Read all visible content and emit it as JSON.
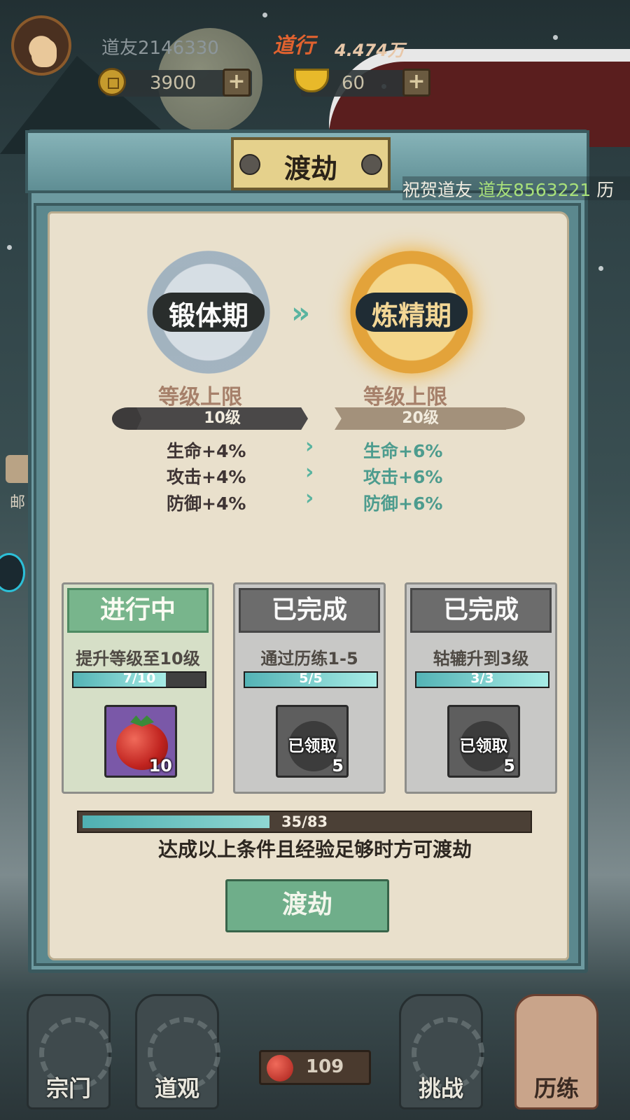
{
  "hud": {
    "username": "道友2146330",
    "daoxing_label": "道行",
    "daoxing_value": "4.474万",
    "coins": "3900",
    "ingots": "60",
    "plus": "+"
  },
  "side": {
    "mail_label": "邮"
  },
  "modal": {
    "title": "渡劫",
    "ticker_prefix": "祝贺道友 ",
    "ticker_name": "道友8563221",
    "ticker_suffix": " 历"
  },
  "realms": {
    "current": {
      "name": "锻体期",
      "cap_title": "等级上限",
      "cap_value": "10级",
      "stats": [
        "生命+4%",
        "攻击+4%",
        "防御+4%"
      ]
    },
    "next": {
      "name": "炼精期",
      "cap_title": "等级上限",
      "cap_value": "20级",
      "stats": [
        "生命+6%",
        "攻击+6%",
        "防御+6%"
      ]
    },
    "arrow": "»",
    "stat_arrow": "›"
  },
  "tasks": [
    {
      "status": "进行中",
      "desc": "提升等级至10级",
      "progress_text": "7/10",
      "progress": 0.7,
      "reward_count": "10",
      "claimed": false
    },
    {
      "status": "已完成",
      "desc": "通过历练1-5",
      "progress_text": "5/5",
      "progress": 1.0,
      "reward_count": "5",
      "claimed": true,
      "claimed_label": "已领取"
    },
    {
      "status": "已完成",
      "desc": "轱辘升到3级",
      "progress_text": "3/3",
      "progress": 1.0,
      "reward_count": "5",
      "claimed": true,
      "claimed_label": "已领取"
    }
  ],
  "exp": {
    "text": "35/83",
    "progress": 0.4217
  },
  "hint": "达成以上条件且经验足够时方可渡劫",
  "action_button": "渡劫",
  "nav": {
    "tabs": [
      "宗门",
      "道观",
      "挑战",
      "历练"
    ],
    "stamina": "109"
  },
  "colors": {
    "in_progress_head": "#78b58c",
    "completed_head": "#6c6c6c",
    "next_stat": "#4d9c8e",
    "daoxing": "#e0622f",
    "ticker_highlight": "#a8e07a"
  }
}
